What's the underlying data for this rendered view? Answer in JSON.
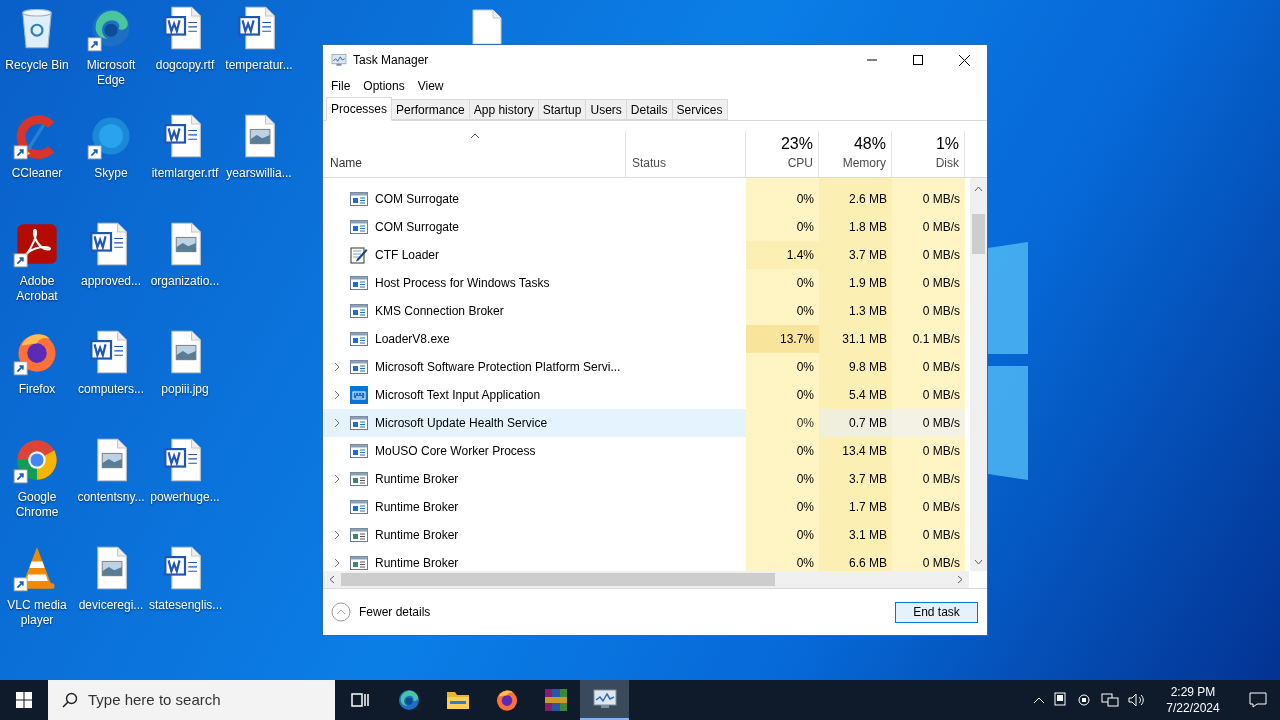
{
  "desktop": {
    "icons": [
      {
        "label": "Recycle Bin",
        "kind": "recycle",
        "shortcut": false
      },
      {
        "label": "CCleaner",
        "kind": "ccleaner",
        "shortcut": true
      },
      {
        "label": "Adobe Acrobat",
        "kind": "acrobat",
        "shortcut": true
      },
      {
        "label": "Firefox",
        "kind": "firefox",
        "shortcut": true
      },
      {
        "label": "Google Chrome",
        "kind": "chrome",
        "shortcut": true
      },
      {
        "label": "VLC media player",
        "kind": "vlc",
        "shortcut": true
      },
      {
        "label": "Microsoft Edge",
        "kind": "edge",
        "shortcut": true
      },
      {
        "label": "Skype",
        "kind": "skype",
        "shortcut": true
      },
      {
        "label": "approved...",
        "kind": "word",
        "shortcut": false
      },
      {
        "label": "computers...",
        "kind": "word",
        "shortcut": false
      },
      {
        "label": "contentsny...",
        "kind": "image",
        "shortcut": false
      },
      {
        "label": "deviceregi...",
        "kind": "image",
        "shortcut": false
      },
      {
        "label": "dogcopy.rtf",
        "kind": "word",
        "shortcut": false
      },
      {
        "label": "itemlarger.rtf",
        "kind": "word",
        "shortcut": false
      },
      {
        "label": "organizatio...",
        "kind": "image",
        "shortcut": false
      },
      {
        "label": "popiii.jpg",
        "kind": "image",
        "shortcut": false
      },
      {
        "label": "powerhuge...",
        "kind": "word",
        "shortcut": false
      },
      {
        "label": "statesenglis...",
        "kind": "word",
        "shortcut": false
      },
      {
        "label": "temperatur...",
        "kind": "word",
        "shortcut": false
      },
      {
        "label": "yearswillia...",
        "kind": "image",
        "shortcut": false
      }
    ]
  },
  "window": {
    "title": "Task Manager",
    "menu": [
      "File",
      "Options",
      "View"
    ],
    "tabs": [
      {
        "label": "Processes",
        "selected": true
      },
      {
        "label": "Performance",
        "selected": false
      },
      {
        "label": "App history",
        "selected": false
      },
      {
        "label": "Startup",
        "selected": false
      },
      {
        "label": "Users",
        "selected": false
      },
      {
        "label": "Details",
        "selected": false
      },
      {
        "label": "Services",
        "selected": false
      }
    ],
    "columns": {
      "name": "Name",
      "status": "Status",
      "metrics": [
        {
          "percent": "23%",
          "label": "CPU"
        },
        {
          "percent": "48%",
          "label": "Memory"
        },
        {
          "percent": "1%",
          "label": "Disk"
        }
      ]
    },
    "rows": [
      {
        "name": "COM Surrogate",
        "kind": "window",
        "expandable": false,
        "selected": false,
        "cpu": {
          "text": "0%",
          "color": "#fff4c4"
        },
        "memory": "2.6 MB",
        "disk": "0 MB/s"
      },
      {
        "name": "COM Surrogate",
        "kind": "window",
        "expandable": false,
        "selected": false,
        "cpu": {
          "text": "0%",
          "color": "#fff4c4"
        },
        "memory": "1.8 MB",
        "disk": "0 MB/s"
      },
      {
        "name": "CTF Loader",
        "kind": "pencil",
        "expandable": false,
        "selected": false,
        "cpu": {
          "text": "1.4%",
          "color": "#fcefb4"
        },
        "memory": "3.7 MB",
        "disk": "0 MB/s"
      },
      {
        "name": "Host Process for Windows Tasks",
        "kind": "window",
        "expandable": false,
        "selected": false,
        "cpu": {
          "text": "0%",
          "color": "#fff4c4"
        },
        "memory": "1.9 MB",
        "disk": "0 MB/s"
      },
      {
        "name": "KMS Connection Broker",
        "kind": "window",
        "expandable": false,
        "selected": false,
        "cpu": {
          "text": "0%",
          "color": "#fff4c4"
        },
        "memory": "1.3 MB",
        "disk": "0 MB/s"
      },
      {
        "name": "LoaderV8.exe",
        "kind": "window",
        "expandable": false,
        "selected": false,
        "cpu": {
          "text": "13.7%",
          "color": "#f9e49c"
        },
        "memory": "31.1 MB",
        "disk": "0.1 MB/s"
      },
      {
        "name": "Microsoft Software Protection Platform Servi...",
        "kind": "window",
        "expandable": true,
        "selected": false,
        "cpu": {
          "text": "0%",
          "color": "#fff4c4"
        },
        "memory": "9.8 MB",
        "disk": "0 MB/s"
      },
      {
        "name": "Microsoft Text Input Application",
        "kind": "keyboard",
        "expandable": true,
        "selected": false,
        "cpu": {
          "text": "0%",
          "color": "#fff4c4"
        },
        "memory": "5.4 MB",
        "disk": "0 MB/s"
      },
      {
        "name": "Microsoft Update Health Service",
        "kind": "window",
        "expandable": true,
        "selected": true,
        "cpu": {
          "text": "0%",
          "color": "#fff4c4"
        },
        "memory": "0.7 MB",
        "disk": "0 MB/s"
      },
      {
        "name": "MoUSO Core Worker Process",
        "kind": "window",
        "expandable": false,
        "selected": false,
        "cpu": {
          "text": "0%",
          "color": "#fff4c4"
        },
        "memory": "13.4 MB",
        "disk": "0 MB/s"
      },
      {
        "name": "Runtime Broker",
        "kind": "list",
        "expandable": true,
        "selected": false,
        "cpu": {
          "text": "0%",
          "color": "#fff4c4"
        },
        "memory": "3.7 MB",
        "disk": "0 MB/s"
      },
      {
        "name": "Runtime Broker",
        "kind": "window",
        "expandable": false,
        "selected": false,
        "cpu": {
          "text": "0%",
          "color": "#fff4c4"
        },
        "memory": "1.7 MB",
        "disk": "0 MB/s"
      },
      {
        "name": "Runtime Broker",
        "kind": "list",
        "expandable": true,
        "selected": false,
        "cpu": {
          "text": "0%",
          "color": "#fff4c4"
        },
        "memory": "3.1 MB",
        "disk": "0 MB/s"
      },
      {
        "name": "Runtime Broker",
        "kind": "list",
        "expandable": true,
        "selected": false,
        "cpu": {
          "text": "0%",
          "color": "#fff4c4"
        },
        "memory": "6.6 MB",
        "disk": "0 MB/s"
      }
    ],
    "footer": {
      "details_toggle": "Fewer details",
      "end_task": "End task"
    }
  },
  "taskbar": {
    "search_placeholder": "Type here to search",
    "apps": [
      {
        "kind": "taskview",
        "active": false
      },
      {
        "kind": "edge",
        "active": false
      },
      {
        "kind": "explorer",
        "active": false
      },
      {
        "kind": "firefox",
        "active": false
      },
      {
        "kind": "winrar",
        "active": false
      },
      {
        "kind": "taskmanager",
        "active": true
      }
    ],
    "clock": {
      "time": "2:29 PM",
      "date": "7/22/2024"
    }
  }
}
